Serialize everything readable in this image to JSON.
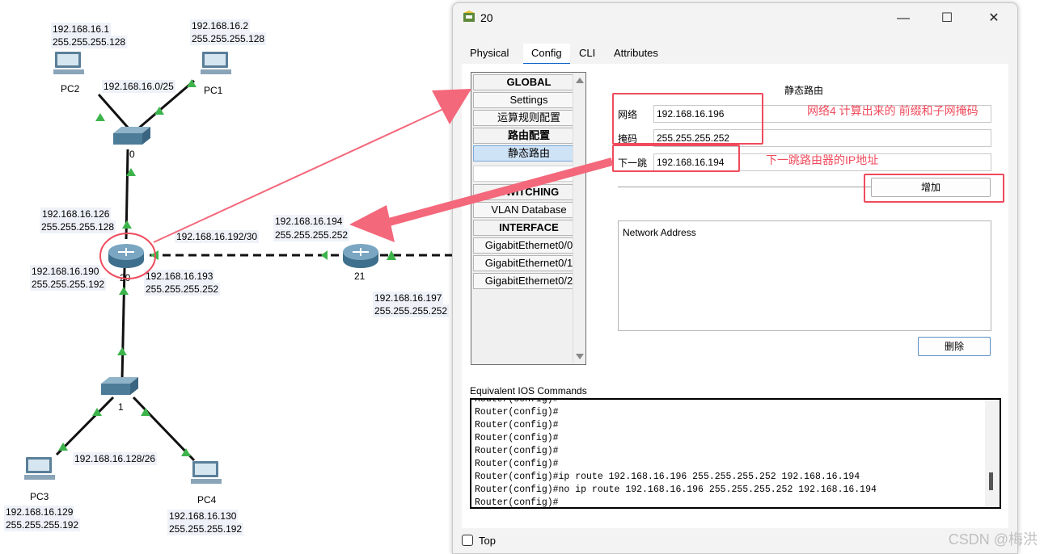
{
  "topology": {
    "devices": {
      "pc2": "PC2",
      "pc1": "PC1",
      "pc3": "PC3",
      "pc4": "PC4",
      "switch0": "0",
      "switch1": "1",
      "router20": "20",
      "router21": "21"
    },
    "labels": {
      "pc2_ip": "192.168.16.1",
      "pc2_mask": "255.255.255.128",
      "pc1_ip": "192.168.16.2",
      "pc1_mask": "255.255.255.128",
      "net_top": "192.168.16.0/25",
      "r20_top_ip": "192.168.16.126",
      "r20_top_mask": "255.255.255.128",
      "net_mid": "192.168.16.192/30",
      "r21_left_ip": "192.168.16.194",
      "r21_left_mask": "255.255.255.252",
      "r20_left_ip": "192.168.16.190",
      "r20_left_mask": "255.255.255.192",
      "r20_right_ip": "192.168.16.193",
      "r20_right_mask": "255.255.255.252",
      "r21_right_ip": "192.168.16.197",
      "r21_right_mask": "255.255.255.252",
      "net_bottom": "192.168.16.128/26",
      "pc3_ip": "192.168.16.129",
      "pc3_mask": "255.255.255.192",
      "pc4_ip": "192.168.16.130",
      "pc4_mask": "255.255.255.192"
    }
  },
  "dialog": {
    "title": "20",
    "window_controls": {
      "minimize": "—",
      "maximize": "☐",
      "close": "✕"
    },
    "tabs": [
      "Physical",
      "Config",
      "CLI",
      "Attributes"
    ],
    "active_tab": "Config",
    "nav": {
      "global": "GLOBAL",
      "settings": "Settings",
      "algorithm": "运算规则配置",
      "routing": "路由配置",
      "static": "静态路由",
      "switching": "SWITCHING",
      "vlan_db": "VLAN Database",
      "interface": "INTERFACE",
      "g0": "GigabitEthernet0/0",
      "g1": "GigabitEthernet0/1",
      "g2": "GigabitEthernet0/2"
    },
    "static_route": {
      "title": "静态路由",
      "network_label": "网络",
      "network_value": "192.168.16.196",
      "mask_label": "掩码",
      "mask_value": "255.255.255.252",
      "nexthop_label": "下一跳",
      "nexthop_value": "192.168.16.194",
      "add_button": "增加",
      "network_address_header": "Network Address",
      "delete_button": "删除"
    },
    "ios": {
      "label": "Equivalent IOS Commands",
      "lines": [
        "Router(config)#",
        "Router(config)#",
        "Router(config)#",
        "Router(config)#",
        "Router(config)#",
        "Router(config)#",
        "Router(config)#ip route 192.168.16.196 255.255.255.252 192.168.16.194",
        "Router(config)#no ip route 192.168.16.196 255.255.255.252 192.168.16.194",
        "Router(config)#"
      ]
    },
    "top_label": "Top"
  },
  "annotations": {
    "network_note": "网络4 计算出来的 前缀和子网掩码",
    "nexthop_note": "下一跳路由器的IP地址",
    "color": "#ef4b5d"
  },
  "watermark": "CSDN @梅洪"
}
